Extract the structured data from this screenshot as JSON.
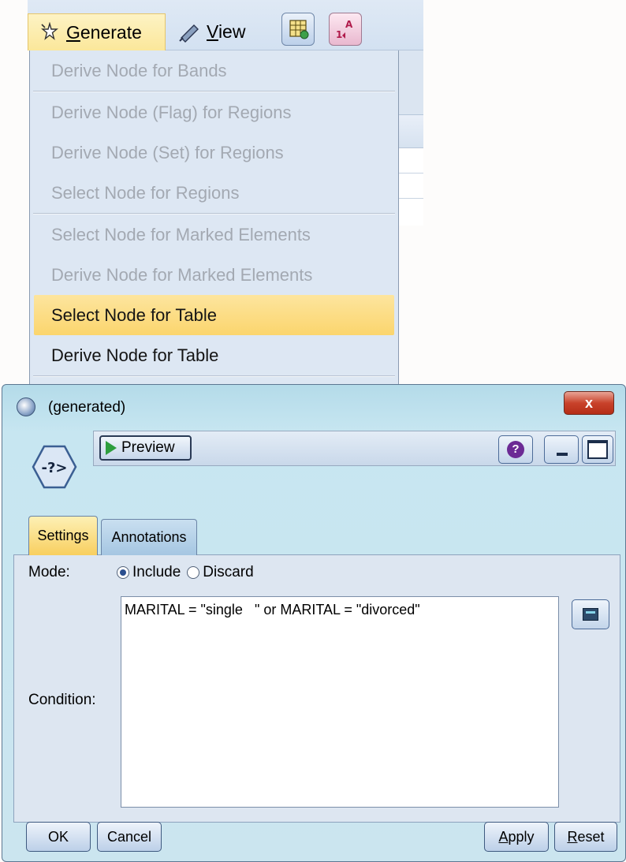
{
  "menubar": {
    "generate_label": "Generate",
    "view_label": "View"
  },
  "generate_menu": {
    "items": [
      {
        "label": "Derive Node for Bands",
        "enabled": false
      },
      {
        "label": "Derive Node (Flag) for Regions",
        "enabled": false
      },
      {
        "label": "Derive Node (Set) for Regions",
        "enabled": false
      },
      {
        "label": "Select Node for Regions",
        "enabled": false
      },
      {
        "label": "Select Node for Marked Elements",
        "enabled": false
      },
      {
        "label": "Derive Node for Marked Elements",
        "enabled": false
      },
      {
        "label": "Select Node for Table",
        "enabled": true,
        "highlighted": true
      },
      {
        "label": "Derive Node for Table",
        "enabled": true
      }
    ]
  },
  "dialog": {
    "title": "(generated)",
    "close_label": "x",
    "node_icon_text": "-?>",
    "preview_label": "Preview",
    "help_label": "?",
    "tabs": [
      {
        "label": "Settings",
        "active": true
      },
      {
        "label": "Annotations",
        "active": false
      }
    ],
    "mode": {
      "label": "Mode:",
      "options": [
        "Include",
        "Discard"
      ],
      "selected": "Include"
    },
    "condition": {
      "label": "Condition:",
      "value": "MARITAL = \"single   \" or MARITAL = \"divorced\""
    },
    "buttons": {
      "ok": "OK",
      "cancel": "Cancel",
      "apply": "Apply",
      "reset": "Reset"
    }
  },
  "colors": {
    "menu_highlight": "#fbd56d",
    "dialog_bg": "#c7e6f1",
    "close_red": "#c9422b",
    "active_tab": "#f8cf5f"
  }
}
